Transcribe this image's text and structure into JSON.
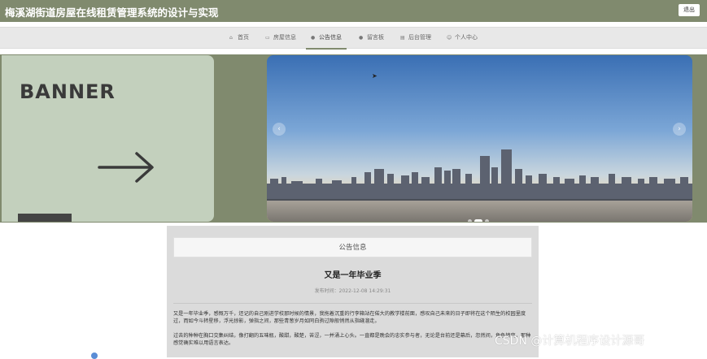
{
  "header": {
    "title": "梅溪湖街道房屋在线租赁管理系统的设计与实现",
    "logout_label": "退出"
  },
  "nav": {
    "items": [
      {
        "label": "首页",
        "icon": "home-icon"
      },
      {
        "label": "房屋信息",
        "icon": "house-icon"
      },
      {
        "label": "公告信息",
        "icon": "notice-icon",
        "active": true
      },
      {
        "label": "留言板",
        "icon": "message-icon"
      },
      {
        "label": "后台管理",
        "icon": "admin-icon"
      },
      {
        "label": "个人中心",
        "icon": "user-icon"
      }
    ]
  },
  "banner": {
    "text": "BANNER"
  },
  "carousel": {
    "prev": "‹",
    "next": "›",
    "dot_count": 3,
    "active_dot": 1
  },
  "announcement": {
    "panel_title": "公告信息",
    "article_title": "又是一年毕业季",
    "publish_time": "发布时间：2022-12-08 14:29:31",
    "paragraphs": [
      "又是一年毕业季，感慨万千，还记的自己刚进学校那时候的情景，我拖着沉重的行李箱站在偌大的教学楼前面，感叹自己未来的日子即将在这个陌生的校园里度过，而如今斗转星移，浮光掠影，弹指之间，那些青葱岁月如同白驹过隙般悄然从指缝溜走。",
      "过去的种种在胸口交集纠结，像打翻的五味瓶，酸甜，酸楚，苦涩，一并涌上心头。一直都是晚会的忠实参与者，无论是台前还是幕后，忽然间，角色转变，那种感觉确实难以用语言表达。"
    ]
  },
  "watermark": "CSDN @计算机程序设计源哥",
  "colors": {
    "accent": "#808a6e",
    "banner_bg": "#c3d0bd",
    "panel_bg": "#dbdbdb"
  }
}
